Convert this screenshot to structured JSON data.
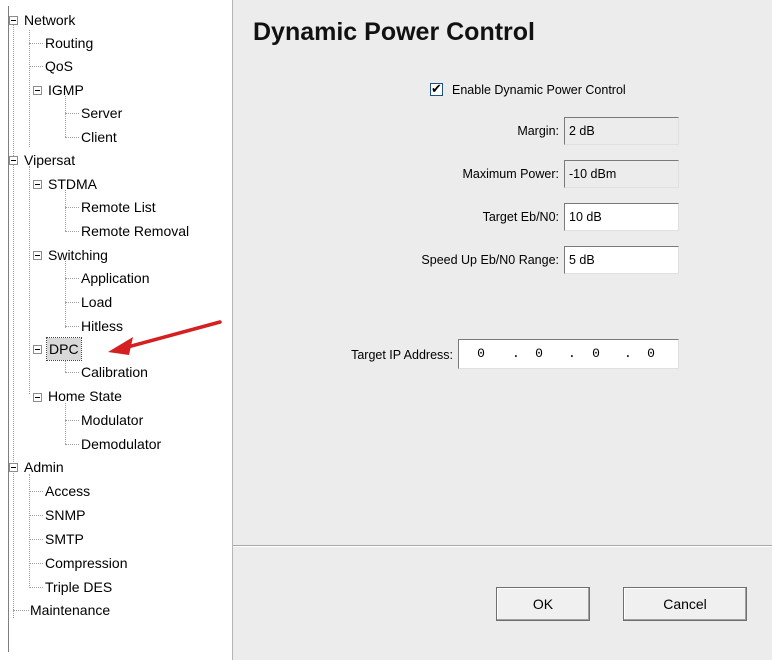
{
  "tree": {
    "items": [
      {
        "label": "Network"
      },
      {
        "label": "Routing"
      },
      {
        "label": "QoS"
      },
      {
        "label": "IGMP"
      },
      {
        "label": "Server"
      },
      {
        "label": "Client"
      },
      {
        "label": "Vipersat"
      },
      {
        "label": "STDMA"
      },
      {
        "label": "Remote List"
      },
      {
        "label": "Remote Removal"
      },
      {
        "label": "Switching"
      },
      {
        "label": "Application"
      },
      {
        "label": "Load"
      },
      {
        "label": "Hitless"
      },
      {
        "label": "DPC"
      },
      {
        "label": "Calibration"
      },
      {
        "label": "Home State"
      },
      {
        "label": "Modulator"
      },
      {
        "label": "Demodulator"
      },
      {
        "label": "Admin"
      },
      {
        "label": "Access"
      },
      {
        "label": "SNMP"
      },
      {
        "label": "SMTP"
      },
      {
        "label": "Compression"
      },
      {
        "label": "Triple DES"
      },
      {
        "label": "Maintenance"
      }
    ],
    "selected": "DPC"
  },
  "main": {
    "title": "Dynamic Power Control",
    "enable_checkbox": {
      "label": "Enable Dynamic Power Control",
      "checked": true
    },
    "margin": {
      "label": "Margin:",
      "value": "2 dB"
    },
    "maximum_power": {
      "label": "Maximum Power:",
      "value": "-10 dBm"
    },
    "target_ebn0": {
      "label": "Target Eb/N0:",
      "value": "10 dB"
    },
    "speed_up_range": {
      "label": "Speed Up Eb/N0 Range:",
      "value": "5 dB"
    },
    "target_ip": {
      "label": "Target IP Address:",
      "octets": [
        "0",
        "0",
        "0",
        "0"
      ],
      "separator": "."
    }
  },
  "buttons": {
    "ok": "OK",
    "cancel": "Cancel"
  },
  "annotation": {
    "arrow_color": "#d42020"
  },
  "colors": {
    "panel_bg": "#ececec",
    "tree_bg": "#ffffff",
    "selected_bg": "#d9d9d9"
  }
}
